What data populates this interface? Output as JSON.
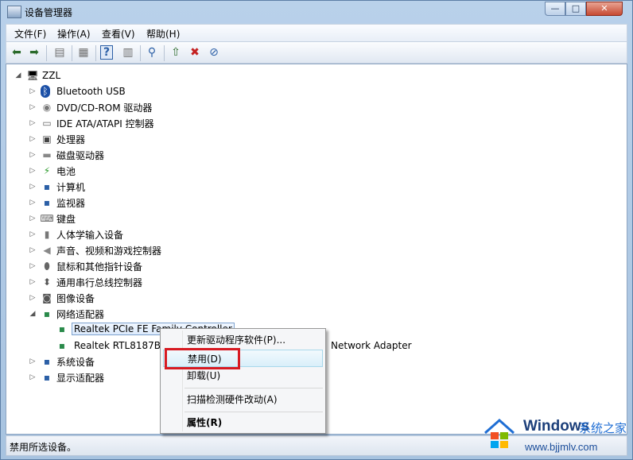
{
  "window": {
    "title": "设备管理器",
    "buttons": {
      "minimize": "—",
      "maximize": "□",
      "close": "✕"
    }
  },
  "menu": [
    {
      "label": "文件(F)"
    },
    {
      "label": "操作(A)"
    },
    {
      "label": "查看(V)"
    },
    {
      "label": "帮助(H)"
    }
  ],
  "toolbar": [
    {
      "icon": "back-arrow-icon",
      "glyph": "⬅"
    },
    {
      "icon": "forward-arrow-icon",
      "glyph": "➡"
    },
    {
      "icon": "show-hide-console-tree-icon",
      "glyph": "▤"
    },
    {
      "icon": "properties-icon",
      "glyph": "▦"
    },
    {
      "icon": "help-icon",
      "glyph": "?"
    },
    {
      "icon": "action-pane-icon",
      "glyph": "▥"
    },
    {
      "icon": "scan-hardware-icon",
      "glyph": "⚲"
    },
    {
      "icon": "update-driver-icon",
      "glyph": "⇧"
    },
    {
      "icon": "uninstall-icon",
      "glyph": "✖"
    },
    {
      "icon": "disable-device-icon",
      "glyph": "⊘"
    }
  ],
  "tree": {
    "root": {
      "label": "ZZL",
      "icon": "computer-icon",
      "glyph": "🖥"
    },
    "categories": [
      {
        "label": "Bluetooth USB",
        "icon": "bluetooth-icon",
        "glyph": "ᛒ"
      },
      {
        "label": "DVD/CD-ROM 驱动器",
        "icon": "dvd-drive-icon",
        "glyph": "◉"
      },
      {
        "label": "IDE ATA/ATAPI 控制器",
        "icon": "ide-controller-icon",
        "glyph": "▭"
      },
      {
        "label": "处理器",
        "icon": "processor-icon",
        "glyph": "▣"
      },
      {
        "label": "磁盘驱动器",
        "icon": "disk-drive-icon",
        "glyph": "▬"
      },
      {
        "label": "电池",
        "icon": "battery-icon",
        "glyph": "⚡"
      },
      {
        "label": "计算机",
        "icon": "computer-category-icon",
        "glyph": "▪"
      },
      {
        "label": "监视器",
        "icon": "monitor-icon",
        "glyph": "▪"
      },
      {
        "label": "键盘",
        "icon": "keyboard-icon",
        "glyph": "⌨"
      },
      {
        "label": "人体学输入设备",
        "icon": "hid-icon",
        "glyph": "▮"
      },
      {
        "label": "声音、视频和游戏控制器",
        "icon": "sound-icon",
        "glyph": "◀"
      },
      {
        "label": "鼠标和其他指针设备",
        "icon": "mouse-icon",
        "glyph": "⬮"
      },
      {
        "label": "通用串行总线控制器",
        "icon": "usb-icon",
        "glyph": "⬍"
      },
      {
        "label": "图像设备",
        "icon": "imaging-device-icon",
        "glyph": "◙"
      },
      {
        "label": "网络适配器",
        "icon": "network-adapter-icon",
        "glyph": "▪"
      }
    ],
    "network_children": [
      {
        "label": "Realtek PCIe FE Family Controller",
        "icon": "network-card-icon",
        "glyph": "▪"
      },
      {
        "label": "Realtek RTL8187B W",
        "suffix": "Network Adapter",
        "icon": "wireless-card-icon",
        "glyph": "▪"
      }
    ],
    "tail_categories": [
      {
        "label": "系统设备",
        "icon": "system-device-icon",
        "glyph": "▪"
      },
      {
        "label": "显示适配器",
        "icon": "display-adapter-icon",
        "glyph": "▪"
      }
    ]
  },
  "context_menu": {
    "update_driver": "更新驱动程序软件(P)...",
    "disable": "禁用(D)",
    "uninstall": "卸载(U)",
    "scan": "扫描检测硬件改动(A)",
    "properties": "属性(R)"
  },
  "status": {
    "text": "禁用所选设备。"
  },
  "watermark": {
    "brand": "Windows",
    "brand_cn": "系统之家",
    "url": "www.bjjmlv.com"
  },
  "colors": {
    "highlight": "#d71a22",
    "selection": "#dceafc"
  }
}
